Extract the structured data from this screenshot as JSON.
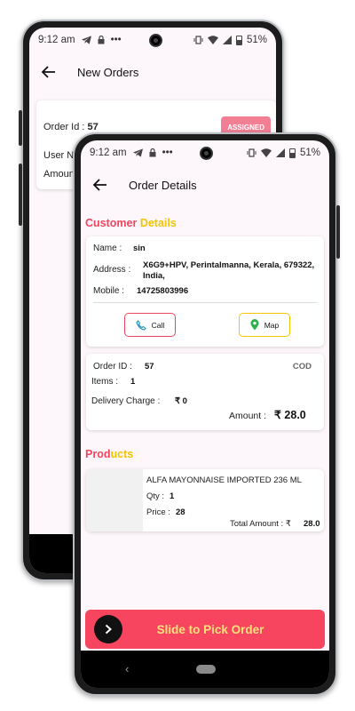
{
  "colors": {
    "accent_pink": "#f0455f",
    "accent_yellow": "#f3c400",
    "slide_bg": "#f74560"
  },
  "status_bar": {
    "time": "9:12 am",
    "dots": "•••",
    "battery": "51%"
  },
  "back_screen": {
    "title": "New Orders",
    "order": {
      "id_label": "Order Id :",
      "id_value": "57",
      "badge": "ASSIGNED",
      "user_label": "User Nar",
      "amount_label": "Amount"
    }
  },
  "front_screen": {
    "title": "Order Details",
    "customer_heading": {
      "part1": "Customer",
      "part2": "Details"
    },
    "customer": {
      "name_label": "Name :",
      "name_value": "sin",
      "address_label": "Address :",
      "address_line1": "X6G9+HPV,  Perintalmanna, Kerala, 679322,",
      "address_line2": "India,",
      "mobile_label": "Mobile :",
      "mobile_value": "14725803996",
      "call_label": "Call",
      "map_label": "Map"
    },
    "order": {
      "id_label": "Order ID :",
      "id_value": "57",
      "payment": "COD",
      "items_label": "Items :",
      "items_value": "1",
      "delivery_label": "Delivery Charge :",
      "delivery_value": "₹ 0",
      "amount_label": "Amount :",
      "amount_value": "₹ 28.0"
    },
    "products_heading": {
      "part1": "Prod",
      "part2": "ucts"
    },
    "product": {
      "name": "ALFA MAYONNAISE  IMPORTED  236 ML",
      "qty_label": "Qty :",
      "qty_value": "1",
      "price_label": "Price :",
      "price_value": "28",
      "total_label": "Total Amount : ₹",
      "total_value": "28.0"
    },
    "slide_label": "Slide to Pick Order",
    "nav_back": "‹"
  }
}
